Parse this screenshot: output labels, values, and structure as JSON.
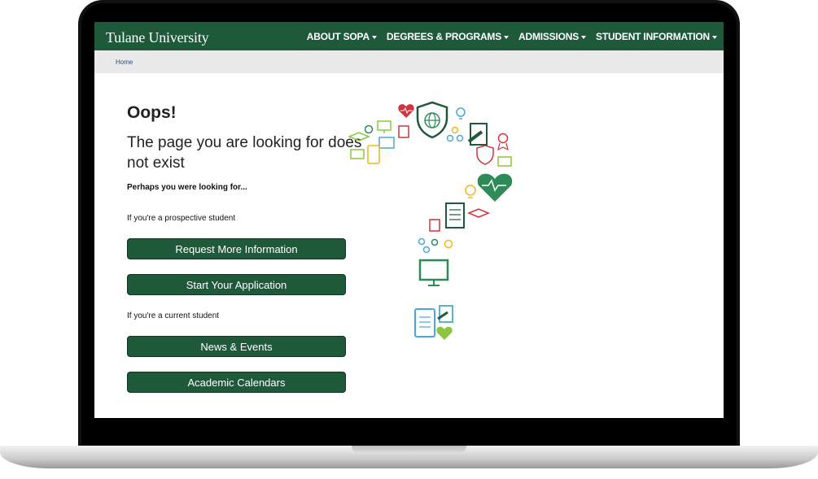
{
  "site": {
    "logo_text": "Tulane University"
  },
  "nav": {
    "items": [
      {
        "label": "ABOUT SOPA"
      },
      {
        "label": "DEGREES & PROGRAMS"
      },
      {
        "label": "ADMISSIONS"
      },
      {
        "label": "STUDENT INFORMATION"
      }
    ]
  },
  "breadcrumb": {
    "home": "Home"
  },
  "error": {
    "heading": "Oops!",
    "message": "The page you are looking for does not exist",
    "suggest": "Perhaps you were looking for..."
  },
  "prospective": {
    "label": "If you're a prospective student",
    "buttons": [
      "Request More Information",
      "Start Your Application"
    ]
  },
  "current": {
    "label": "If you're a current student",
    "buttons": [
      "News & Events",
      "Academic Calendars"
    ]
  },
  "colors": {
    "brand_green": "#1e5a3a",
    "icon_red": "#d2343f",
    "icon_yellow": "#f2b51c",
    "icon_blue": "#4aa7d8",
    "icon_green": "#2e8b57",
    "icon_lime": "#8cc63f"
  }
}
